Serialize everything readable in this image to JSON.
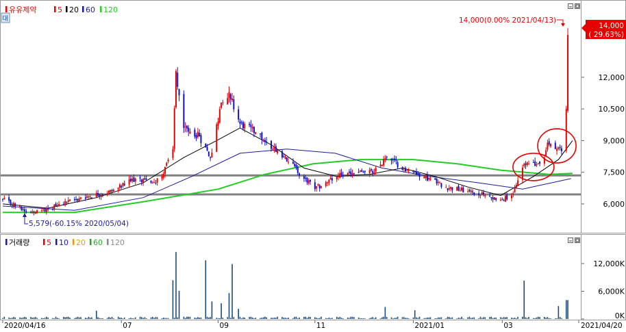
{
  "colors": {
    "up": "#e60000",
    "down": "#1010c8",
    "ma5": "#e60000",
    "ma20": "#000000",
    "ma60": "#1a1aa0",
    "ma120": "#22cc22",
    "ma120_legend": "#8a8a8a",
    "vol_bar": "#1a4a7a",
    "hline": "#808080",
    "circle": "#e60000",
    "price_tag_bg": "#e60000",
    "price_tag_fg": "#ffffff"
  },
  "price_panel": {
    "legend_name": "유유제약",
    "legend_items": [
      {
        "label": "5",
        "color": "#e60000"
      },
      {
        "label": "20",
        "color": "#000000"
      },
      {
        "label": "60",
        "color": "#1a1aa0"
      },
      {
        "label": "120",
        "color": "#22cc22"
      }
    ],
    "side_tab": "대",
    "high_annotation": "14,000(0.00% 2021/04/13)",
    "low_annotation": "5,579(-60.15% 2020/05/04)",
    "price_tag_value": "14,000",
    "price_tag_change": "( 29.63%)"
  },
  "volume_panel": {
    "legend_name": "거래량",
    "legend_items": [
      {
        "label": "5",
        "color": "#e60000"
      },
      {
        "label": "10",
        "color": "#1a1aa0"
      },
      {
        "label": "20",
        "color": "#e8a000"
      },
      {
        "label": "60",
        "color": "#22aa22"
      },
      {
        "label": "120",
        "color": "#8a8a8a"
      }
    ]
  },
  "chart_data": {
    "type": "candlestick",
    "price_axis": {
      "ylim": [
        4700,
        15400
      ],
      "ticks": [
        6000,
        7500,
        9000,
        10500,
        12000
      ],
      "tick_labels": [
        "6,000",
        "7,500",
        "9,000",
        "10,500",
        "12,000"
      ]
    },
    "volume_axis": {
      "ylim": [
        0,
        16000
      ],
      "ticks": [
        0,
        6000,
        12000
      ],
      "tick_labels": [
        "0K",
        "6,000K",
        "12,000K"
      ]
    },
    "x_labels": [
      {
        "label": "2020/04/16",
        "date": "2020-04-16"
      },
      {
        "label": "07",
        "date": "2020-07-01"
      },
      {
        "label": "09",
        "date": "2020-09-01"
      },
      {
        "label": "11",
        "date": "2020-11-02"
      },
      {
        "label": "2021/01",
        "date": "2021-01-04"
      },
      {
        "label": "03",
        "date": "2021-03-02"
      },
      {
        "label": "2021/04/20",
        "date": "2021-04-20"
      }
    ],
    "x_range": [
      "2020-04-16",
      "2021-04-20"
    ],
    "horizontal_lines": [
      7350,
      6450
    ],
    "highlight_circles": [
      {
        "date": "2021-03-22",
        "price": 7750
      },
      {
        "date": "2021-04-06",
        "price": 8750
      }
    ],
    "price_points": [
      [
        "2020-04-16",
        6200
      ],
      [
        "2020-05-04",
        5579
      ],
      [
        "2020-05-20",
        5900
      ],
      [
        "2020-06-05",
        6300
      ],
      [
        "2020-06-25",
        6600
      ],
      [
        "2020-07-10",
        7200
      ],
      [
        "2020-07-20",
        7000
      ],
      [
        "2020-07-27",
        7300
      ],
      [
        "2020-08-03",
        8600
      ],
      [
        "2020-08-05",
        12300
      ],
      [
        "2020-08-10",
        9600
      ],
      [
        "2020-08-20",
        9200
      ],
      [
        "2020-08-27",
        8200
      ],
      [
        "2020-09-03",
        10800
      ],
      [
        "2020-09-08",
        11300
      ],
      [
        "2020-09-15",
        9800
      ],
      [
        "2020-09-25",
        9400
      ],
      [
        "2020-10-06",
        8600
      ],
      [
        "2020-10-16",
        8000
      ],
      [
        "2020-10-27",
        7200
      ],
      [
        "2020-11-02",
        6700
      ],
      [
        "2020-11-16",
        7300
      ],
      [
        "2020-11-30",
        7500
      ],
      [
        "2020-12-10",
        7500
      ],
      [
        "2020-12-18",
        8200
      ],
      [
        "2020-12-29",
        7700
      ],
      [
        "2021-01-11",
        7300
      ],
      [
        "2021-01-25",
        6800
      ],
      [
        "2021-02-08",
        6600
      ],
      [
        "2021-02-19",
        6400
      ],
      [
        "2021-03-02",
        6200
      ],
      [
        "2021-03-09",
        6500
      ],
      [
        "2021-03-16",
        7900
      ],
      [
        "2021-03-23",
        7800
      ],
      [
        "2021-03-29",
        8200
      ],
      [
        "2021-03-31",
        8900
      ],
      [
        "2021-04-05",
        8600
      ],
      [
        "2021-04-09",
        8500
      ],
      [
        "2021-04-12",
        10500
      ],
      [
        "2021-04-13",
        14000
      ]
    ],
    "ma20_points": [
      [
        "2020-04-16",
        6000
      ],
      [
        "2020-05-15",
        5800
      ],
      [
        "2020-06-15",
        6300
      ],
      [
        "2020-07-15",
        7000
      ],
      [
        "2020-08-10",
        8200
      ],
      [
        "2020-08-31",
        9000
      ],
      [
        "2020-09-15",
        9600
      ],
      [
        "2020-10-05",
        8800
      ],
      [
        "2020-10-26",
        7700
      ],
      [
        "2020-11-16",
        7300
      ],
      [
        "2020-12-07",
        7400
      ],
      [
        "2020-12-28",
        7700
      ],
      [
        "2021-01-18",
        7300
      ],
      [
        "2021-02-08",
        6800
      ],
      [
        "2021-03-01",
        6400
      ],
      [
        "2021-03-22",
        7300
      ],
      [
        "2021-04-07",
        8100
      ],
      [
        "2021-04-16",
        9000
      ]
    ],
    "ma60_points": [
      [
        "2020-04-16",
        5900
      ],
      [
        "2020-06-01",
        5700
      ],
      [
        "2020-07-15",
        6300
      ],
      [
        "2020-08-15",
        7300
      ],
      [
        "2020-09-15",
        8400
      ],
      [
        "2020-10-15",
        8600
      ],
      [
        "2020-11-15",
        8400
      ],
      [
        "2020-12-15",
        7700
      ],
      [
        "2021-01-15",
        7300
      ],
      [
        "2021-02-15",
        7000
      ],
      [
        "2021-03-15",
        6700
      ],
      [
        "2021-04-15",
        7200
      ]
    ],
    "ma120_points": [
      [
        "2020-04-16",
        5600
      ],
      [
        "2020-06-01",
        5600
      ],
      [
        "2020-07-15",
        6100
      ],
      [
        "2020-09-01",
        6700
      ],
      [
        "2020-10-01",
        7400
      ],
      [
        "2020-11-01",
        7900
      ],
      [
        "2020-12-01",
        8100
      ],
      [
        "2021-01-04",
        8100
      ],
      [
        "2021-02-01",
        7900
      ],
      [
        "2021-03-01",
        7600
      ],
      [
        "2021-04-01",
        7400
      ],
      [
        "2021-04-16",
        7450
      ]
    ],
    "volume_spikes_k": [
      [
        "2020-06-15",
        1800
      ],
      [
        "2020-08-03",
        8400
      ],
      [
        "2020-08-05",
        14500
      ],
      [
        "2020-08-07",
        6100
      ],
      [
        "2020-08-24",
        12700
      ],
      [
        "2020-08-28",
        3800
      ],
      [
        "2020-09-03",
        3400
      ],
      [
        "2020-09-08",
        5600
      ],
      [
        "2020-09-10",
        11900
      ],
      [
        "2020-09-14",
        2200
      ],
      [
        "2020-12-17",
        2600
      ],
      [
        "2021-01-05",
        1900
      ],
      [
        "2021-03-16",
        8300
      ],
      [
        "2021-04-07",
        2800
      ],
      [
        "2021-04-12",
        4100
      ],
      [
        "2021-04-13",
        4100
      ]
    ],
    "volume_baseline_k": 300
  }
}
